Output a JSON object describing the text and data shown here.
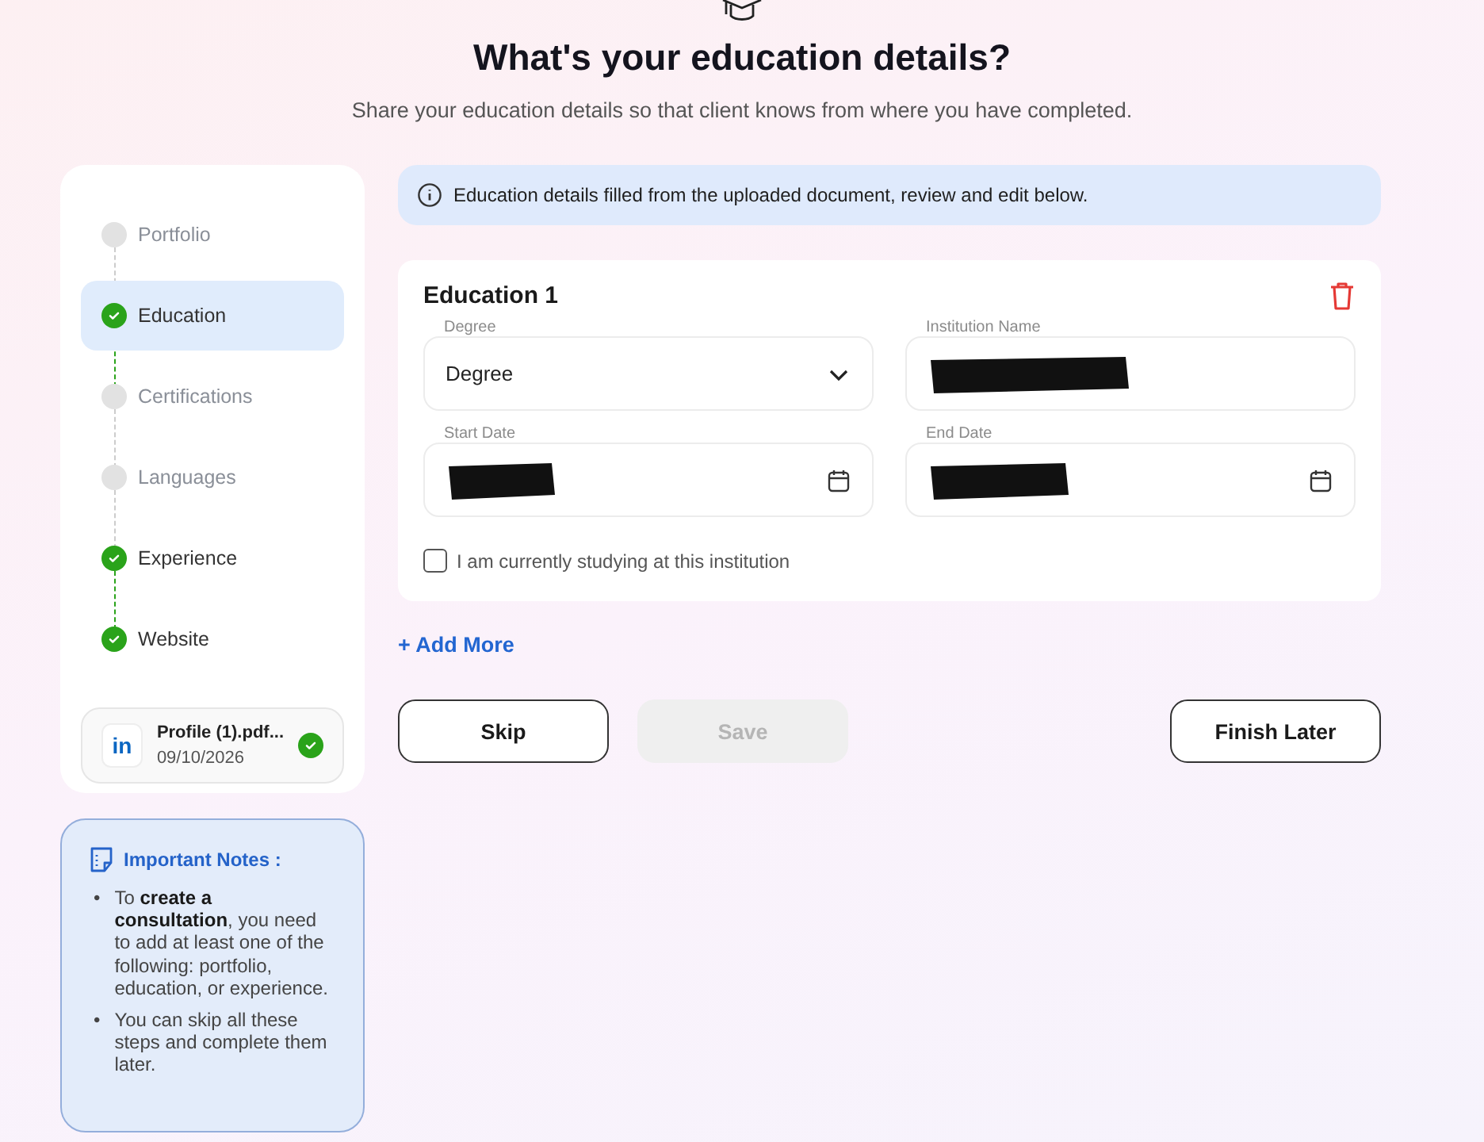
{
  "header": {
    "title": "What's your education details?",
    "subtitle": "Share your education details so that client knows from where you have completed."
  },
  "steps": [
    {
      "label": "Portfolio",
      "done": false,
      "selected": false
    },
    {
      "label": "Education",
      "done": true,
      "selected": true
    },
    {
      "label": "Certifications",
      "done": false,
      "selected": false
    },
    {
      "label": "Languages",
      "done": false,
      "selected": false
    },
    {
      "label": "Experience",
      "done": true,
      "selected": false
    },
    {
      "label": "Website",
      "done": true,
      "selected": false
    }
  ],
  "document": {
    "name": "Profile (1).pdf...",
    "date": "09/10/2026",
    "verified": true,
    "badge": "in"
  },
  "notes": {
    "title": "Important Notes :",
    "items": [
      {
        "bullet": "•",
        "text": "To **create a consultation**, you need to add at least one of the following: portfolio, education, or experience."
      },
      {
        "bullet": "•",
        "text": "You can skip all these steps and complete them later."
      }
    ]
  },
  "banner": "Education details filled from the uploaded document, review and edit below.",
  "education": {
    "title": "Education 1",
    "fields": [
      {
        "kind": "select",
        "label": "Degree",
        "value": "Degree",
        "redacted": false
      },
      {
        "kind": "text",
        "label": "Institution Name",
        "redacted": true
      },
      {
        "kind": "date",
        "label": "Start Date",
        "redacted": true
      },
      {
        "kind": "date",
        "label": "End Date",
        "redacted": true
      }
    ],
    "current": {
      "label": "I am currently studying at this institution",
      "checked": false
    }
  },
  "add_more": "+ Add More",
  "buttons": [
    {
      "label": "Skip",
      "disabled": false
    },
    {
      "label": "Save",
      "disabled": true
    },
    {
      "label": "Finish Later",
      "disabled": false
    }
  ]
}
